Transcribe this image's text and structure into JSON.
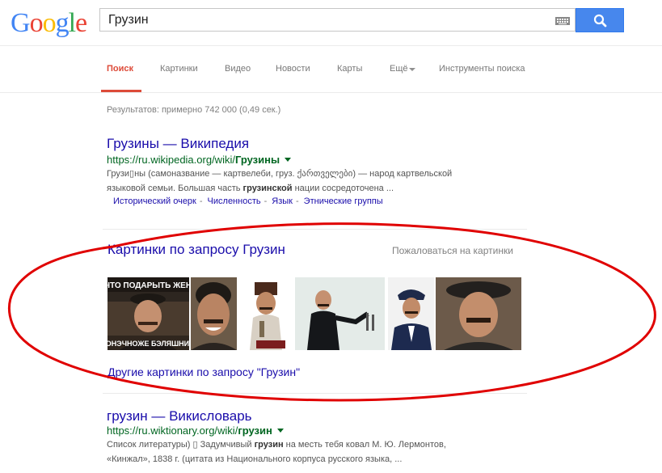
{
  "header": {
    "logo": "Google",
    "logo_letters": [
      {
        "ch": "G",
        "color": "#4285f4"
      },
      {
        "ch": "o",
        "color": "#ea4335"
      },
      {
        "ch": "o",
        "color": "#fbbc05"
      },
      {
        "ch": "g",
        "color": "#4285f4"
      },
      {
        "ch": "l",
        "color": "#34a853"
      },
      {
        "ch": "e",
        "color": "#ea4335"
      }
    ],
    "search_value": "Грузин",
    "keyboard_icon": "keyboard-icon",
    "search_icon": "search-icon"
  },
  "nav": {
    "items": [
      "Поиск",
      "Картинки",
      "Видео",
      "Новости",
      "Карты",
      "Ещё",
      "Инструменты поиска"
    ],
    "active_index": 0
  },
  "stats": "Результатов: примерно 742 000 (0,49 сек.)",
  "results": [
    {
      "title": "Грузины — Википедия",
      "url_prefix": "https://ru.wikipedia.org/wiki/",
      "url_bold": "Грузины",
      "snippet_line1": "Грузи▯ны (самоназвание — картвелеби, груз. ქართველები) — народ картвельской",
      "snippet_line2_pre": "языковой семьи. Большая часть ",
      "snippet_line2_bold": "грузинской",
      "snippet_line2_post": " нации сосредоточена ...",
      "sitelinks": [
        "Исторический очерк",
        "Численность",
        "Язык",
        "Этнические группы"
      ]
    },
    {
      "title": "грузин — Викисловарь",
      "url_prefix": "https://ru.wiktionary.org/wiki/",
      "url_bold": "грузин",
      "snippet_line1_pre": "Список литературы) ▯ Задумчивый ",
      "snippet_line1_bold": "грузин",
      "snippet_line1_post": " на месть тебя ковал М. Ю. Лермонтов,",
      "snippet_line2": "«Кинжал», 1838 г. (цитата из Национального корпуса русского языка, ..."
    }
  ],
  "images_block": {
    "title": "Картинки по запросу Грузин",
    "report": "Пожаловаться на картинки",
    "thumb1_caption_top": "ЧТО ПОДАРЫТЬ ЖЕН",
    "thumb1_caption_bottom": "КОНЭЧНОЖЕ БЭЛЯШНИЦ",
    "more": "Другие картинки по запросу \"Грузин\""
  },
  "colors": {
    "link": "#1a0dab",
    "url_green": "#006621",
    "active_tab": "#dd4b39",
    "search_button": "#4787ed",
    "annotation_red": "#e00000"
  }
}
